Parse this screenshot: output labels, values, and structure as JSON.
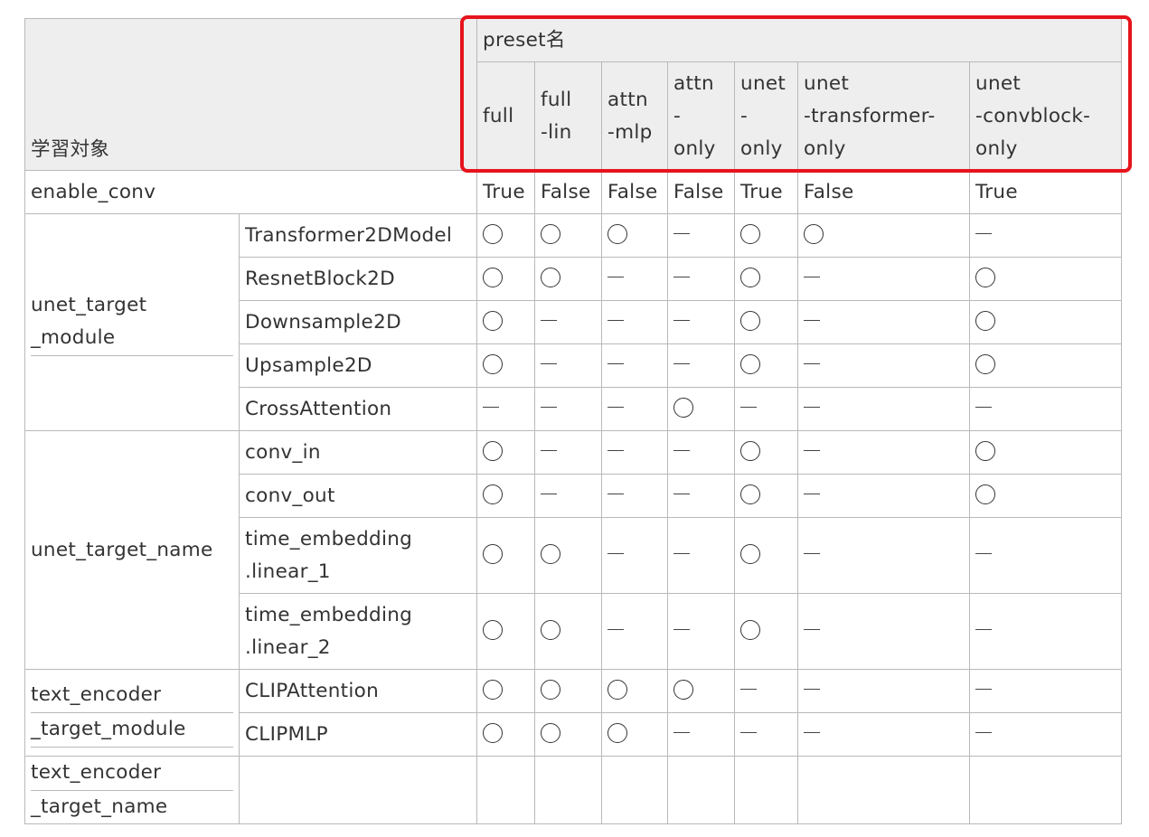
{
  "header": {
    "corner_label": "学習対象",
    "preset_title": "preset名",
    "presets": [
      [
        "full"
      ],
      [
        "full",
        "-lin"
      ],
      [
        "attn",
        "-mlp"
      ],
      [
        "attn",
        "-",
        "only"
      ],
      [
        "unet",
        "-",
        "only"
      ],
      [
        "unet",
        "-transformer-",
        "only"
      ],
      [
        "unet",
        "-convblock-",
        "only"
      ]
    ]
  },
  "enable_conv": {
    "label": "enable_conv",
    "values": [
      "True",
      "False",
      "False",
      "False",
      "True",
      "False",
      "True"
    ]
  },
  "groups": [
    {
      "lines": [
        "unet_target",
        "_module"
      ],
      "linked": [
        false,
        true
      ],
      "rows": [
        {
          "name": [
            "Transformer2DModel"
          ],
          "marks": [
            "○",
            "○",
            "○",
            "—",
            "○",
            "○",
            "—"
          ]
        },
        {
          "name": [
            "ResnetBlock2D"
          ],
          "marks": [
            "○",
            "○",
            "—",
            "—",
            "○",
            "—",
            "○"
          ]
        },
        {
          "name": [
            "Downsample2D"
          ],
          "marks": [
            "○",
            "—",
            "—",
            "—",
            "○",
            "—",
            "○"
          ]
        },
        {
          "name": [
            "Upsample2D"
          ],
          "marks": [
            "○",
            "—",
            "—",
            "—",
            "○",
            "—",
            "○"
          ]
        },
        {
          "name": [
            "CrossAttention"
          ],
          "marks": [
            "—",
            "—",
            "—",
            "○",
            "—",
            "—",
            "—"
          ]
        }
      ]
    },
    {
      "lines": [
        "unet_target_name"
      ],
      "linked": [
        false
      ],
      "rows": [
        {
          "name": [
            "conv_in"
          ],
          "marks": [
            "○",
            "—",
            "—",
            "—",
            "○",
            "—",
            "○"
          ]
        },
        {
          "name": [
            "conv_out"
          ],
          "marks": [
            "○",
            "—",
            "—",
            "—",
            "○",
            "—",
            "○"
          ]
        },
        {
          "name": [
            "time_embedding",
            ".linear_1"
          ],
          "marks": [
            "○",
            "○",
            "—",
            "—",
            "○",
            "—",
            "—"
          ]
        },
        {
          "name": [
            "time_embedding",
            ".linear_2"
          ],
          "marks": [
            "○",
            "○",
            "—",
            "—",
            "○",
            "—",
            "—"
          ]
        }
      ]
    },
    {
      "lines": [
        "text_encoder",
        "_target_module"
      ],
      "linked": [
        true,
        true
      ],
      "rows": [
        {
          "name": [
            "CLIPAttention"
          ],
          "marks": [
            "○",
            "○",
            "○",
            "○",
            "—",
            "—",
            "—"
          ]
        },
        {
          "name": [
            "CLIPMLP"
          ],
          "marks": [
            "○",
            "○",
            "○",
            "—",
            "—",
            "—",
            "—"
          ]
        }
      ]
    },
    {
      "lines": [
        "text_encoder",
        "_target_name"
      ],
      "linked": [
        true,
        false
      ],
      "rows": [
        {
          "name": [],
          "marks": [
            "",
            "",
            "",
            "",
            "",
            "",
            ""
          ]
        }
      ]
    }
  ],
  "colors": {
    "header_bg": "#eeeeee",
    "border": "#b9b9b9",
    "text": "#333333",
    "highlight": "#e6141c"
  }
}
